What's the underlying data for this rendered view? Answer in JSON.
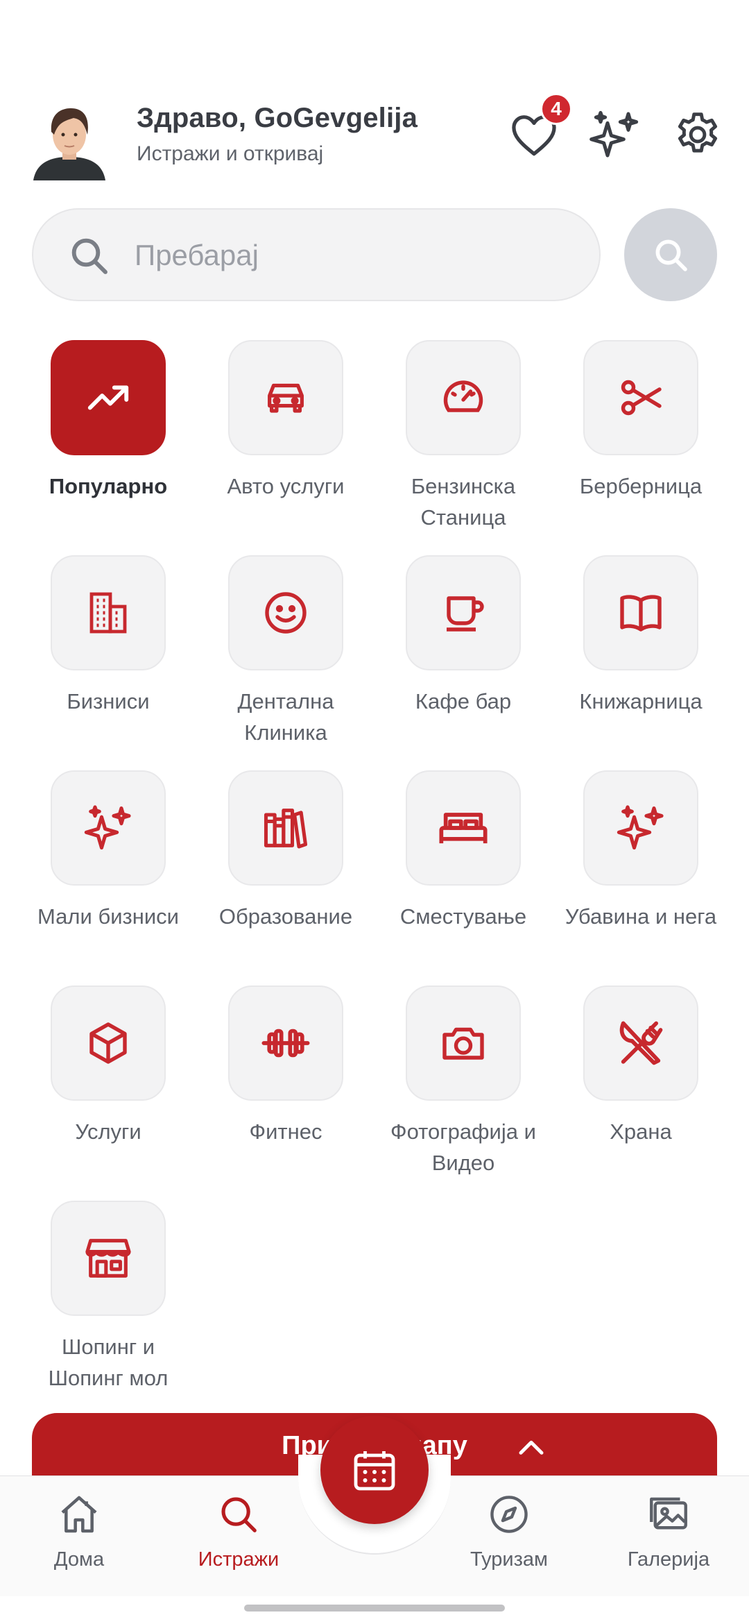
{
  "header": {
    "greeting": "Здраво, GoGevgelija",
    "subtitle": "Истражи и откривај",
    "favorites_count": "4"
  },
  "search": {
    "placeholder": "Пребарај"
  },
  "categories": [
    {
      "label": "Популарно",
      "icon": "trending-up-icon",
      "active": true
    },
    {
      "label": "Авто услуги",
      "icon": "car-icon"
    },
    {
      "label": "Бензинска Станица",
      "icon": "speedometer-icon"
    },
    {
      "label": "Берберница",
      "icon": "scissors-icon"
    },
    {
      "label": "Бизниси",
      "icon": "office-building-icon"
    },
    {
      "label": "Дентална Клиника",
      "icon": "smile-icon"
    },
    {
      "label": "Кафе бар",
      "icon": "coffee-cup-icon"
    },
    {
      "label": "Книжарница",
      "icon": "open-book-icon"
    },
    {
      "label": "Мали бизниси",
      "icon": "sparkles-icon"
    },
    {
      "label": "Образование",
      "icon": "books-icon"
    },
    {
      "label": "Сместување",
      "icon": "bed-icon"
    },
    {
      "label": "Убавина и нега",
      "icon": "sparkles-icon"
    },
    {
      "label": "Услуги",
      "icon": "cube-icon"
    },
    {
      "label": "Фитнес",
      "icon": "dumbbell-icon"
    },
    {
      "label": "Фотографија и Видео",
      "icon": "camera-icon"
    },
    {
      "label": "Храна",
      "icon": "fork-knife-icon"
    },
    {
      "label": "Шопинг и Шопинг мол",
      "icon": "storefront-icon"
    }
  ],
  "show_bar": {
    "label": "Прикажи мапу"
  },
  "nav": {
    "home": "Дома",
    "explore": "Истражи",
    "tourism": "Туризам",
    "gallery": "Галерија"
  },
  "colors": {
    "accent": "#b71c1f",
    "badge": "#d0282f",
    "tile_bg": "#f3f3f4"
  }
}
